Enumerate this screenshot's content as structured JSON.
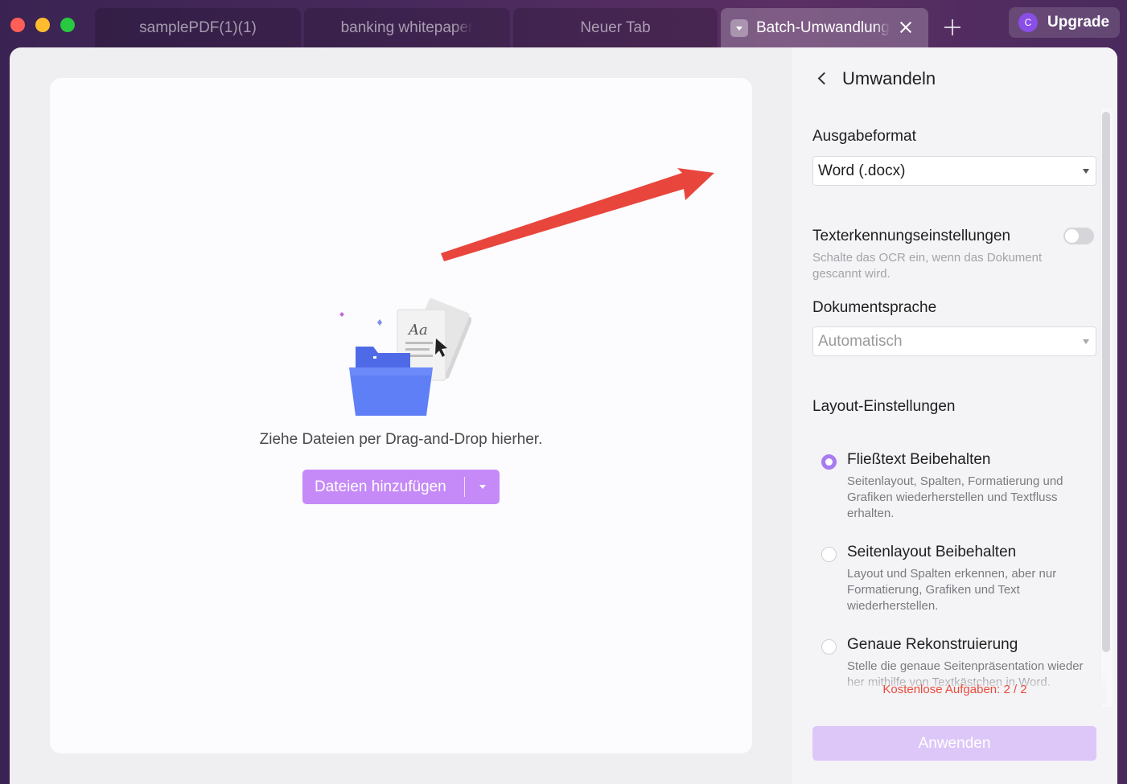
{
  "tabs": [
    {
      "label": "samplePDF(1)(1)"
    },
    {
      "label": "banking whitepaper"
    },
    {
      "label": "Neuer Tab"
    },
    {
      "label": "Batch-Umwandlung"
    }
  ],
  "account": {
    "avatar_letter": "C",
    "upgrade_label": "Upgrade"
  },
  "dropzone": {
    "text": "Ziehe Dateien per Drag-and-Drop hierher.",
    "add_button_label": "Dateien hinzufügen",
    "illustration_text": "Aa"
  },
  "panel": {
    "title": "Umwandeln",
    "output_format": {
      "label": "Ausgabeformat",
      "value": "Word (.docx)"
    },
    "ocr": {
      "label": "Texterkennungseinstellungen",
      "hint": "Schalte das OCR ein, wenn das Dokument gescannt wird.",
      "enabled": false
    },
    "document_language": {
      "label": "Dokumentsprache",
      "value": "Automatisch"
    },
    "layout": {
      "label": "Layout-Einstellungen",
      "options": [
        {
          "title": "Fließtext Beibehalten",
          "description": "Seitenlayout, Spalten, Formatierung und Grafiken wiederherstellen und Textfluss erhalten.",
          "selected": true
        },
        {
          "title": "Seitenlayout Beibehalten",
          "description": "Layout und Spalten erkennen, aber nur Formatierung, Grafiken und Text wiederherstellen.",
          "selected": false
        },
        {
          "title": "Genaue Rekonstruierung",
          "description": "Stelle die genaue Seitenpräsentation wieder her mithilfe von Textkästchen in Word.",
          "selected": false
        }
      ]
    },
    "free_tasks": "Kostenlose Aufgaben: 2 / 2",
    "apply_label": "Anwenden"
  },
  "colors": {
    "accent": "#c58af7",
    "annotation_arrow": "#e8453c",
    "warning_text": "#e94b3c"
  }
}
